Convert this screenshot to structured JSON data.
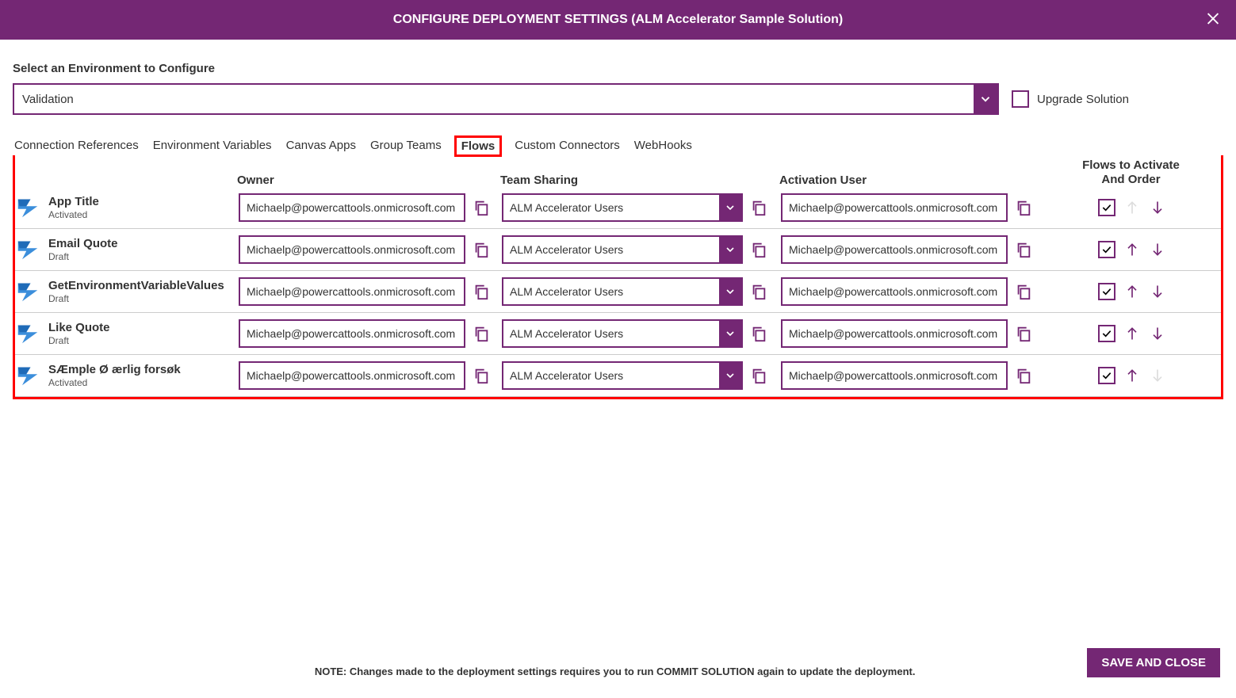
{
  "header": {
    "title": "CONFIGURE DEPLOYMENT SETTINGS (ALM Accelerator Sample Solution)"
  },
  "envSection": {
    "label": "Select an Environment to Configure",
    "selected": "Validation",
    "upgradeLabel": "Upgrade Solution",
    "upgradeChecked": false
  },
  "tabs": [
    {
      "label": "Connection References",
      "active": false
    },
    {
      "label": "Environment Variables",
      "active": false
    },
    {
      "label": "Canvas Apps",
      "active": false
    },
    {
      "label": "Group Teams",
      "active": false
    },
    {
      "label": "Flows",
      "active": true
    },
    {
      "label": "Custom Connectors",
      "active": false
    },
    {
      "label": "WebHooks",
      "active": false
    }
  ],
  "columns": {
    "owner": "Owner",
    "team": "Team Sharing",
    "activation": "Activation User",
    "orderLine1": "Flows to Activate",
    "orderLine2": "And Order"
  },
  "rows": [
    {
      "name": "App Title",
      "status": "Activated",
      "owner": "Michaelp@powercattools.onmicrosoft.com",
      "team": "ALM Accelerator Users",
      "activationUser": "Michaelp@powercattools.onmicrosoft.com",
      "checked": true,
      "upEnabled": false,
      "downEnabled": true
    },
    {
      "name": "Email Quote",
      "status": "Draft",
      "owner": "Michaelp@powercattools.onmicrosoft.com",
      "team": "ALM Accelerator Users",
      "activationUser": "Michaelp@powercattools.onmicrosoft.com",
      "checked": true,
      "upEnabled": true,
      "downEnabled": true
    },
    {
      "name": "GetEnvironmentVariableValues",
      "status": "Draft",
      "owner": "Michaelp@powercattools.onmicrosoft.com",
      "team": "ALM Accelerator Users",
      "activationUser": "Michaelp@powercattools.onmicrosoft.com",
      "checked": true,
      "upEnabled": true,
      "downEnabled": true
    },
    {
      "name": "Like Quote",
      "status": "Draft",
      "owner": "Michaelp@powercattools.onmicrosoft.com",
      "team": "ALM Accelerator Users",
      "activationUser": "Michaelp@powercattools.onmicrosoft.com",
      "checked": true,
      "upEnabled": true,
      "downEnabled": true
    },
    {
      "name": "SÆmple Ø ærlig forsøk",
      "status": "Activated",
      "owner": "Michaelp@powercattools.onmicrosoft.com",
      "team": "ALM Accelerator Users",
      "activationUser": "Michaelp@powercattools.onmicrosoft.com",
      "checked": true,
      "upEnabled": true,
      "downEnabled": false
    }
  ],
  "footer": {
    "note": "NOTE: Changes made to the deployment settings requires you to run COMMIT SOLUTION again to update the deployment.",
    "saveLabel": "SAVE AND CLOSE"
  }
}
